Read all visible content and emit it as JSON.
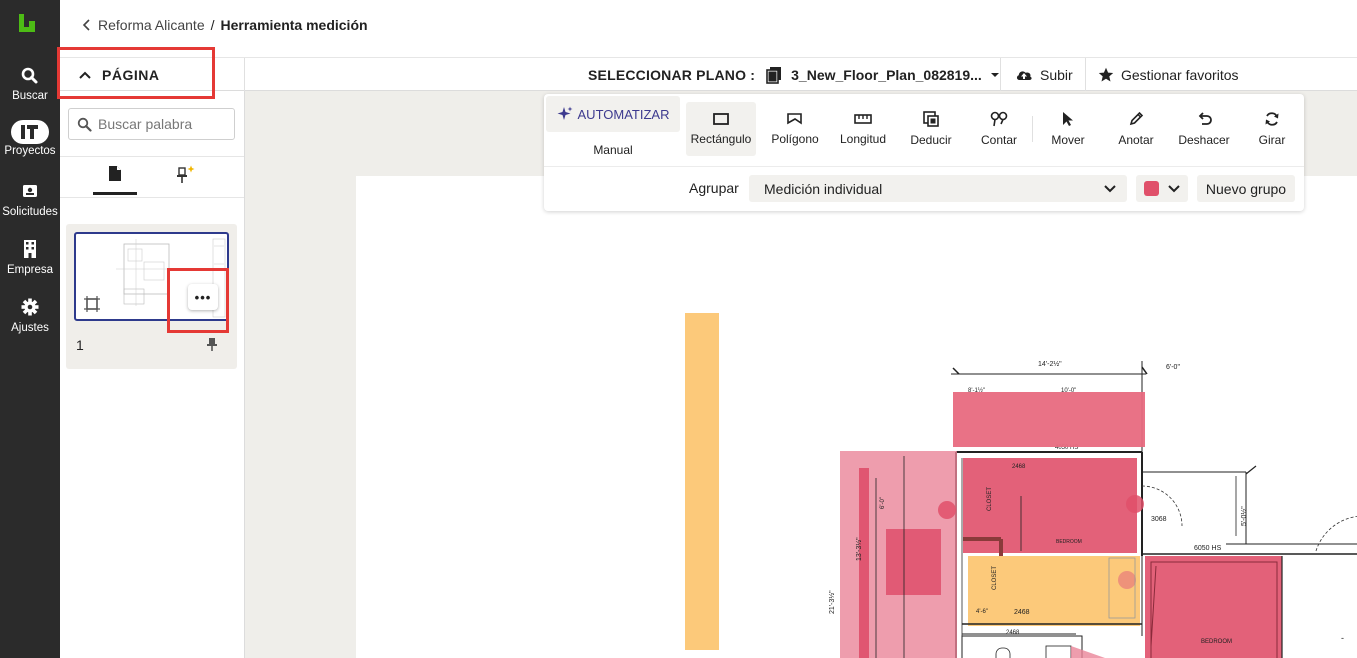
{
  "nav": {
    "items": [
      {
        "label": "Buscar",
        "icon": "search-icon"
      },
      {
        "label": "Proyectos",
        "icon": "projects-icon"
      },
      {
        "label": "Solicitudes",
        "icon": "requests-icon"
      },
      {
        "label": "Empresa",
        "icon": "building-icon"
      },
      {
        "label": "Ajustes",
        "icon": "gear-icon"
      }
    ]
  },
  "breadcrumb": {
    "parent": "Reforma Alicante",
    "separator": "/",
    "current": "Herramienta medición"
  },
  "subbar": {
    "page_toggle": "PÁGINA",
    "plano_label": "SELECCIONAR PLANO :",
    "plano_value": "3_New_Floor_Plan_082819...",
    "upload": "Subir",
    "favorites": "Gestionar favoritos"
  },
  "panel": {
    "search_placeholder": "Buscar palabra",
    "page_number": "1",
    "more": "•••"
  },
  "tools": {
    "automate": "AUTOMATIZAR",
    "manual": "Manual",
    "items": [
      {
        "label": "Rectángulo",
        "icon": "rectangle-icon"
      },
      {
        "label": "Polígono",
        "icon": "polygon-icon"
      },
      {
        "label": "Longitud",
        "icon": "ruler-icon"
      },
      {
        "label": "Deducir",
        "icon": "deduct-icon"
      },
      {
        "label": "Contar",
        "icon": "count-icon"
      },
      {
        "label": "Mover",
        "icon": "cursor-icon"
      },
      {
        "label": "Anotar",
        "icon": "pen-icon"
      },
      {
        "label": "Deshacer",
        "icon": "undo-icon"
      },
      {
        "label": "Girar",
        "icon": "rotate-icon"
      }
    ],
    "group_label": "Agrupar",
    "group_value": "Medición individual",
    "new_group": "Nuevo grupo"
  },
  "colors": {
    "accent": "#e0506a",
    "nav_bg": "#2b2b2b",
    "highlight": "#e53935",
    "automate": "#3d3a8f",
    "orange_measure": "#fcc97a",
    "pink_measure": "#e86a80"
  }
}
